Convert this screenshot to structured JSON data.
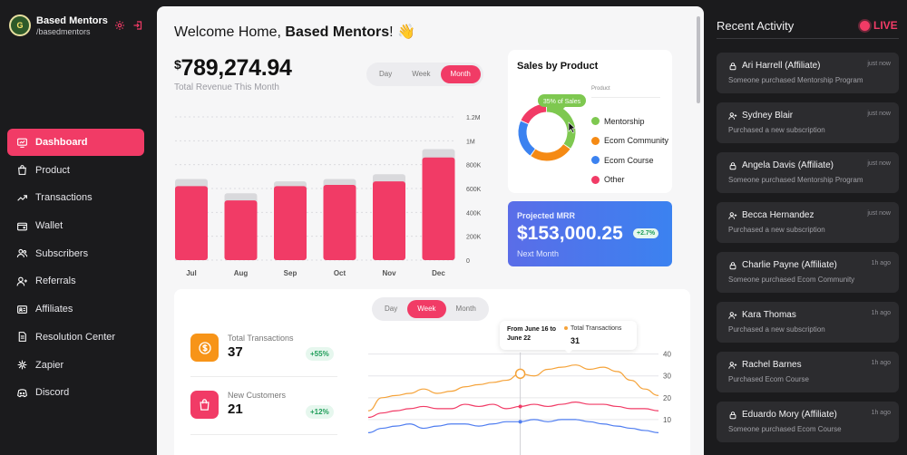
{
  "brand": {
    "name": "Based Mentors",
    "handle": "/basedmentors",
    "logo_text": "G"
  },
  "nav": {
    "items": [
      {
        "label": "Dashboard",
        "icon": "dashboard-icon",
        "active": true
      },
      {
        "label": "Product",
        "icon": "bag-icon"
      },
      {
        "label": "Transactions",
        "icon": "trend-icon"
      },
      {
        "label": "Wallet",
        "icon": "wallet-icon"
      },
      {
        "label": "Subscribers",
        "icon": "users-icon"
      },
      {
        "label": "Referrals",
        "icon": "user-plus-icon"
      },
      {
        "label": "Affiliates",
        "icon": "id-card-icon"
      },
      {
        "label": "Resolution Center",
        "icon": "document-icon"
      },
      {
        "label": "Zapier",
        "icon": "zapier-icon"
      },
      {
        "label": "Discord",
        "icon": "discord-icon"
      }
    ]
  },
  "header": {
    "welcome_prefix": "Welcome Home, ",
    "welcome_name": "Based Mentors",
    "welcome_suffix": "!",
    "emoji": "👋"
  },
  "revenue": {
    "currency": "$",
    "value": "789,274.94",
    "label": "Total Revenue This Month"
  },
  "revenue_toggle": {
    "options": [
      "Day",
      "Week",
      "Month"
    ],
    "selected": "Month"
  },
  "sales_by_product": {
    "title": "Sales by Product",
    "legend_header": "Product",
    "tooltip": "35% of Sales"
  },
  "mrr": {
    "label": "Projected MRR",
    "value": "$153,000.25",
    "badge": "+2.7%",
    "sub": "Next Month"
  },
  "lower_toggle": {
    "options": [
      "Day",
      "Week",
      "Month"
    ],
    "selected": "Week"
  },
  "stats": [
    {
      "label": "Total Transactions",
      "value": "37",
      "badge": "+55%",
      "color": "#f79418",
      "icon": "dollar-coin-icon"
    },
    {
      "label": "New Customers",
      "value": "21",
      "badge": "+12%",
      "color": "#f13b66",
      "icon": "shopping-bag-icon"
    }
  ],
  "line_tooltip": {
    "range": "From June 16 to June 22",
    "series": "Total Transactions",
    "value": "31"
  },
  "activity": {
    "title": "Recent Activity",
    "live_label": "LIVE",
    "items": [
      {
        "name": "Ari Harrell (Affiliate)",
        "time": "just now",
        "desc": "Someone purchased Mentorship Program",
        "icon": "lock-icon"
      },
      {
        "name": "Sydney Blair",
        "time": "just now",
        "desc": "Purchased a new subscription",
        "icon": "user-plus-icon"
      },
      {
        "name": "Angela Davis (Affiliate)",
        "time": "just now",
        "desc": "Someone purchased Mentorship Program",
        "icon": "lock-icon"
      },
      {
        "name": "Becca Hernandez",
        "time": "just now",
        "desc": "Purchased a new subscription",
        "icon": "user-plus-icon"
      },
      {
        "name": "Charlie Payne (Affiliate)",
        "time": "1h ago",
        "desc": "Someone purchased Ecom Community",
        "icon": "lock-icon"
      },
      {
        "name": "Kara Thomas",
        "time": "1h ago",
        "desc": "Purchased a new subscription",
        "icon": "user-plus-icon"
      },
      {
        "name": "Rachel Barnes",
        "time": "1h ago",
        "desc": "Purchased Ecom Course",
        "icon": "user-plus-icon"
      },
      {
        "name": "Eduardo Mory (Affiliate)",
        "time": "1h ago",
        "desc": "Someone purchased Ecom Course",
        "icon": "lock-icon"
      }
    ]
  },
  "colors": {
    "accent": "#f13b66",
    "bar_back": "#d9d9dc",
    "mentorship": "#7ec850",
    "ecom_community": "#f58a14",
    "ecom_course": "#3b82f0",
    "other": "#f13b66"
  },
  "chart_data": [
    {
      "type": "bar",
      "categories": [
        "Jul",
        "Aug",
        "Sep",
        "Oct",
        "Nov",
        "Dec"
      ],
      "series": [
        {
          "values": [
            680000,
            560000,
            660000,
            680000,
            720000,
            930000
          ]
        },
        {
          "values": [
            620000,
            500000,
            620000,
            630000,
            660000,
            860000
          ]
        }
      ],
      "yticks": [
        "0",
        "200K",
        "400K",
        "600K",
        "800K",
        "1M",
        "1.2M"
      ],
      "ylim": [
        0,
        1200000
      ]
    },
    {
      "type": "pie",
      "labels": [
        "Mentorship",
        "Ecom Community",
        "Ecom Course",
        "Other"
      ],
      "values": [
        35,
        25,
        22,
        18
      ],
      "title": "Sales by Product"
    },
    {
      "type": "line",
      "x": [
        0,
        1,
        2,
        3,
        4,
        5,
        6,
        7,
        8,
        9,
        10,
        11,
        12,
        13,
        14,
        15,
        16,
        17,
        18,
        19,
        20,
        21
      ],
      "series": [
        {
          "name": "Total Transactions",
          "values": [
            14,
            20,
            21,
            22,
            24,
            22,
            23,
            25,
            26,
            27,
            28,
            31,
            30,
            33,
            34,
            35,
            33,
            34,
            32,
            28,
            24,
            21
          ]
        },
        {
          "values": [
            11,
            13,
            14,
            15,
            16,
            15,
            15,
            17,
            16,
            17,
            15,
            16,
            17,
            16,
            17,
            18,
            17,
            17,
            16,
            15,
            15,
            14
          ]
        },
        {
          "values": [
            4,
            6,
            7,
            8,
            6,
            7,
            8,
            8,
            7,
            8,
            9,
            9,
            10,
            9,
            10,
            10,
            9,
            8,
            7,
            6,
            5,
            4
          ]
        }
      ],
      "yticks": [
        "10",
        "20",
        "30",
        "40"
      ],
      "ylim": [
        0,
        44
      ]
    }
  ]
}
